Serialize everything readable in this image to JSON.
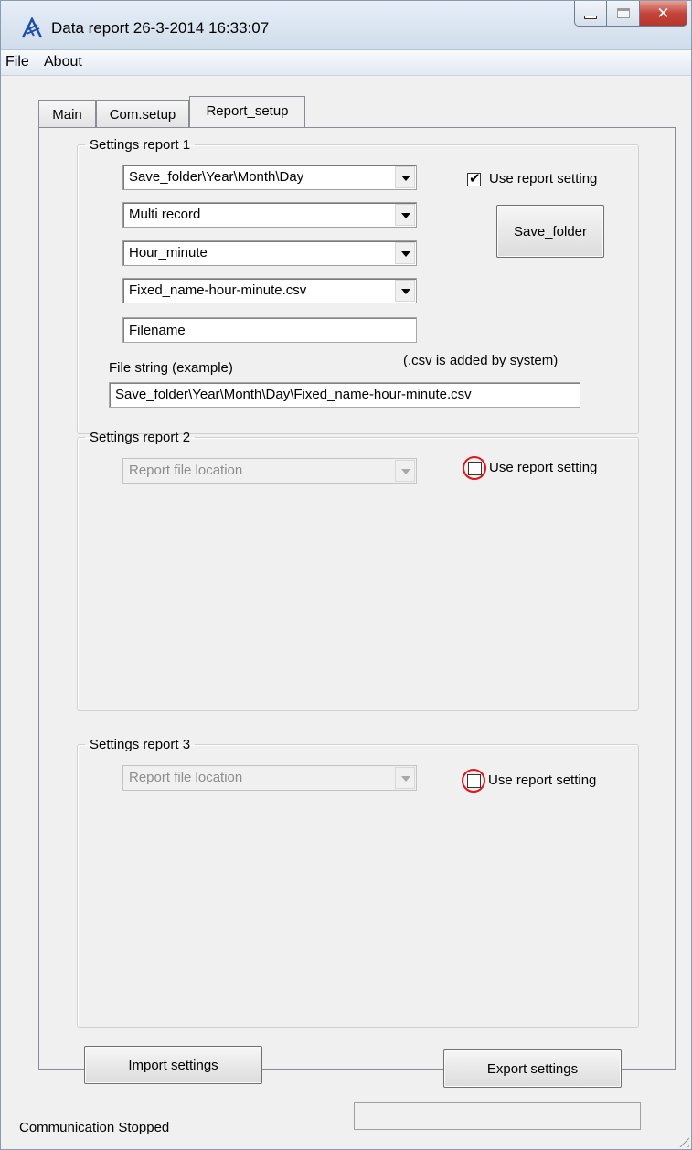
{
  "window": {
    "title": "Data report 26-3-2014 16:33:07"
  },
  "menu": {
    "file": "File",
    "about": "About"
  },
  "tabs": [
    "Main",
    "Com.setup",
    "Report_setup"
  ],
  "report1": {
    "legend": "Settings report 1",
    "location": "Save_folder\\Year\\Month\\Day",
    "mode": "Multi record",
    "time_format": "Hour_minute",
    "name_format": "Fixed_name-hour-minute.csv",
    "filename": "Filename",
    "use_label": "Use report setting",
    "use_checked": true,
    "save_folder_button": "Save_folder",
    "csv_note": "(.csv is added by system)",
    "file_string_label": "File string (example)",
    "file_string": "Save_folder\\Year\\Month\\Day\\Fixed_name-hour-minute.csv"
  },
  "report2": {
    "legend": "Settings report 2",
    "location": "Report file location",
    "use_label": "Use report setting",
    "use_checked": false
  },
  "report3": {
    "legend": "Settings report 3",
    "location": "Report file location",
    "use_label": "Use report setting",
    "use_checked": false
  },
  "buttons": {
    "import": "Import settings",
    "export": "Export settings"
  },
  "status": {
    "text": "Communication Stopped"
  },
  "annotation_color": "#e0141b"
}
